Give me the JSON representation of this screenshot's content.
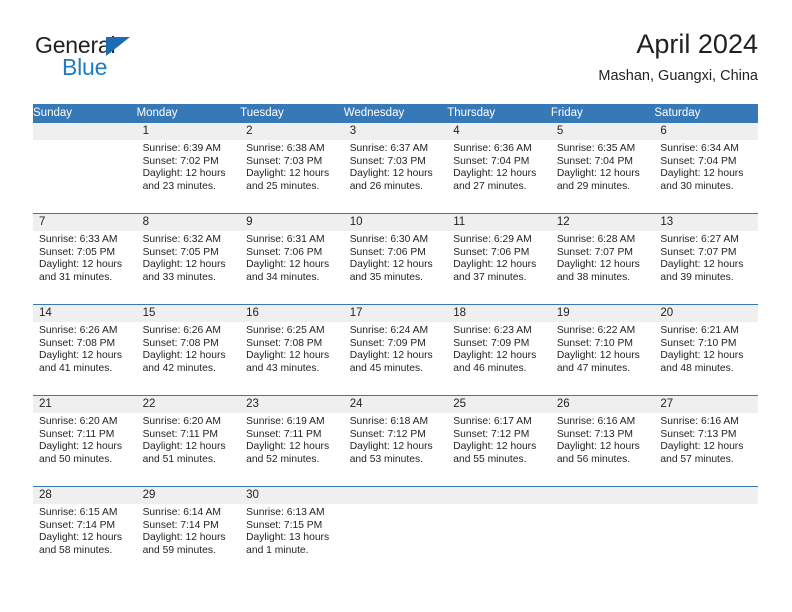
{
  "logo": {
    "word1": "General",
    "word2": "Blue",
    "triangle_color": "#1d6cb3",
    "word2_color": "#1f7cc4"
  },
  "header": {
    "title": "April 2024",
    "subtitle": "Mashan, Guangxi, China",
    "accent_color": "#3778b7",
    "daynum_band_color": "#efefef"
  },
  "calendar": {
    "weekday_headers": [
      "Sunday",
      "Monday",
      "Tuesday",
      "Wednesday",
      "Thursday",
      "Friday",
      "Saturday"
    ],
    "weeks": [
      [
        {
          "day": "",
          "sunrise": "",
          "sunset": "",
          "daylight_a": "",
          "daylight_b": ""
        },
        {
          "day": "1",
          "sunrise": "Sunrise: 6:39 AM",
          "sunset": "Sunset: 7:02 PM",
          "daylight_a": "Daylight: 12 hours",
          "daylight_b": "and 23 minutes."
        },
        {
          "day": "2",
          "sunrise": "Sunrise: 6:38 AM",
          "sunset": "Sunset: 7:03 PM",
          "daylight_a": "Daylight: 12 hours",
          "daylight_b": "and 25 minutes."
        },
        {
          "day": "3",
          "sunrise": "Sunrise: 6:37 AM",
          "sunset": "Sunset: 7:03 PM",
          "daylight_a": "Daylight: 12 hours",
          "daylight_b": "and 26 minutes."
        },
        {
          "day": "4",
          "sunrise": "Sunrise: 6:36 AM",
          "sunset": "Sunset: 7:04 PM",
          "daylight_a": "Daylight: 12 hours",
          "daylight_b": "and 27 minutes."
        },
        {
          "day": "5",
          "sunrise": "Sunrise: 6:35 AM",
          "sunset": "Sunset: 7:04 PM",
          "daylight_a": "Daylight: 12 hours",
          "daylight_b": "and 29 minutes."
        },
        {
          "day": "6",
          "sunrise": "Sunrise: 6:34 AM",
          "sunset": "Sunset: 7:04 PM",
          "daylight_a": "Daylight: 12 hours",
          "daylight_b": "and 30 minutes."
        }
      ],
      [
        {
          "day": "7",
          "sunrise": "Sunrise: 6:33 AM",
          "sunset": "Sunset: 7:05 PM",
          "daylight_a": "Daylight: 12 hours",
          "daylight_b": "and 31 minutes."
        },
        {
          "day": "8",
          "sunrise": "Sunrise: 6:32 AM",
          "sunset": "Sunset: 7:05 PM",
          "daylight_a": "Daylight: 12 hours",
          "daylight_b": "and 33 minutes."
        },
        {
          "day": "9",
          "sunrise": "Sunrise: 6:31 AM",
          "sunset": "Sunset: 7:06 PM",
          "daylight_a": "Daylight: 12 hours",
          "daylight_b": "and 34 minutes."
        },
        {
          "day": "10",
          "sunrise": "Sunrise: 6:30 AM",
          "sunset": "Sunset: 7:06 PM",
          "daylight_a": "Daylight: 12 hours",
          "daylight_b": "and 35 minutes."
        },
        {
          "day": "11",
          "sunrise": "Sunrise: 6:29 AM",
          "sunset": "Sunset: 7:06 PM",
          "daylight_a": "Daylight: 12 hours",
          "daylight_b": "and 37 minutes."
        },
        {
          "day": "12",
          "sunrise": "Sunrise: 6:28 AM",
          "sunset": "Sunset: 7:07 PM",
          "daylight_a": "Daylight: 12 hours",
          "daylight_b": "and 38 minutes."
        },
        {
          "day": "13",
          "sunrise": "Sunrise: 6:27 AM",
          "sunset": "Sunset: 7:07 PM",
          "daylight_a": "Daylight: 12 hours",
          "daylight_b": "and 39 minutes."
        }
      ],
      [
        {
          "day": "14",
          "sunrise": "Sunrise: 6:26 AM",
          "sunset": "Sunset: 7:08 PM",
          "daylight_a": "Daylight: 12 hours",
          "daylight_b": "and 41 minutes."
        },
        {
          "day": "15",
          "sunrise": "Sunrise: 6:26 AM",
          "sunset": "Sunset: 7:08 PM",
          "daylight_a": "Daylight: 12 hours",
          "daylight_b": "and 42 minutes."
        },
        {
          "day": "16",
          "sunrise": "Sunrise: 6:25 AM",
          "sunset": "Sunset: 7:08 PM",
          "daylight_a": "Daylight: 12 hours",
          "daylight_b": "and 43 minutes."
        },
        {
          "day": "17",
          "sunrise": "Sunrise: 6:24 AM",
          "sunset": "Sunset: 7:09 PM",
          "daylight_a": "Daylight: 12 hours",
          "daylight_b": "and 45 minutes."
        },
        {
          "day": "18",
          "sunrise": "Sunrise: 6:23 AM",
          "sunset": "Sunset: 7:09 PM",
          "daylight_a": "Daylight: 12 hours",
          "daylight_b": "and 46 minutes."
        },
        {
          "day": "19",
          "sunrise": "Sunrise: 6:22 AM",
          "sunset": "Sunset: 7:10 PM",
          "daylight_a": "Daylight: 12 hours",
          "daylight_b": "and 47 minutes."
        },
        {
          "day": "20",
          "sunrise": "Sunrise: 6:21 AM",
          "sunset": "Sunset: 7:10 PM",
          "daylight_a": "Daylight: 12 hours",
          "daylight_b": "and 48 minutes."
        }
      ],
      [
        {
          "day": "21",
          "sunrise": "Sunrise: 6:20 AM",
          "sunset": "Sunset: 7:11 PM",
          "daylight_a": "Daylight: 12 hours",
          "daylight_b": "and 50 minutes."
        },
        {
          "day": "22",
          "sunrise": "Sunrise: 6:20 AM",
          "sunset": "Sunset: 7:11 PM",
          "daylight_a": "Daylight: 12 hours",
          "daylight_b": "and 51 minutes."
        },
        {
          "day": "23",
          "sunrise": "Sunrise: 6:19 AM",
          "sunset": "Sunset: 7:11 PM",
          "daylight_a": "Daylight: 12 hours",
          "daylight_b": "and 52 minutes."
        },
        {
          "day": "24",
          "sunrise": "Sunrise: 6:18 AM",
          "sunset": "Sunset: 7:12 PM",
          "daylight_a": "Daylight: 12 hours",
          "daylight_b": "and 53 minutes."
        },
        {
          "day": "25",
          "sunrise": "Sunrise: 6:17 AM",
          "sunset": "Sunset: 7:12 PM",
          "daylight_a": "Daylight: 12 hours",
          "daylight_b": "and 55 minutes."
        },
        {
          "day": "26",
          "sunrise": "Sunrise: 6:16 AM",
          "sunset": "Sunset: 7:13 PM",
          "daylight_a": "Daylight: 12 hours",
          "daylight_b": "and 56 minutes."
        },
        {
          "day": "27",
          "sunrise": "Sunrise: 6:16 AM",
          "sunset": "Sunset: 7:13 PM",
          "daylight_a": "Daylight: 12 hours",
          "daylight_b": "and 57 minutes."
        }
      ],
      [
        {
          "day": "28",
          "sunrise": "Sunrise: 6:15 AM",
          "sunset": "Sunset: 7:14 PM",
          "daylight_a": "Daylight: 12 hours",
          "daylight_b": "and 58 minutes."
        },
        {
          "day": "29",
          "sunrise": "Sunrise: 6:14 AM",
          "sunset": "Sunset: 7:14 PM",
          "daylight_a": "Daylight: 12 hours",
          "daylight_b": "and 59 minutes."
        },
        {
          "day": "30",
          "sunrise": "Sunrise: 6:13 AM",
          "sunset": "Sunset: 7:15 PM",
          "daylight_a": "Daylight: 13 hours",
          "daylight_b": "and 1 minute."
        },
        {
          "day": "",
          "sunrise": "",
          "sunset": "",
          "daylight_a": "",
          "daylight_b": ""
        },
        {
          "day": "",
          "sunrise": "",
          "sunset": "",
          "daylight_a": "",
          "daylight_b": ""
        },
        {
          "day": "",
          "sunrise": "",
          "sunset": "",
          "daylight_a": "",
          "daylight_b": ""
        },
        {
          "day": "",
          "sunrise": "",
          "sunset": "",
          "daylight_a": "",
          "daylight_b": ""
        }
      ]
    ]
  }
}
